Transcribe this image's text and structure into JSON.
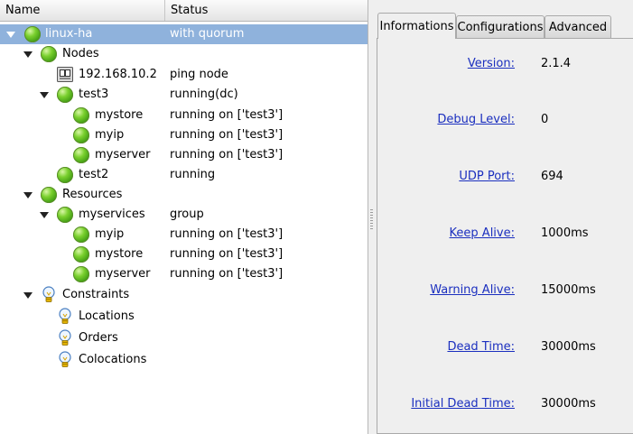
{
  "tree": {
    "columns": {
      "name": "Name",
      "status": "Status"
    },
    "rows": [
      {
        "label": "linux-ha",
        "status": "with quorum"
      },
      {
        "label": "Nodes",
        "status": ""
      },
      {
        "label": "192.168.10.2",
        "status": "ping node"
      },
      {
        "label": "test3",
        "status": "running(dc)"
      },
      {
        "label": "mystore",
        "status": "running on ['test3']"
      },
      {
        "label": "myip",
        "status": "running on ['test3']"
      },
      {
        "label": "myserver",
        "status": "running on ['test3']"
      },
      {
        "label": "test2",
        "status": "running"
      },
      {
        "label": "Resources",
        "status": ""
      },
      {
        "label": "myservices",
        "status": "group"
      },
      {
        "label": "myip",
        "status": "running on ['test3']"
      },
      {
        "label": "mystore",
        "status": "running on ['test3']"
      },
      {
        "label": "myserver",
        "status": "running on ['test3']"
      },
      {
        "label": "Constraints",
        "status": ""
      },
      {
        "label": "Locations",
        "status": ""
      },
      {
        "label": "Orders",
        "status": ""
      },
      {
        "label": "Colocations",
        "status": ""
      }
    ]
  },
  "tabs": [
    {
      "label": "Informations"
    },
    {
      "label": "Configurations"
    },
    {
      "label": "Advanced"
    }
  ],
  "info": [
    {
      "key": "Version:",
      "value": "2.1.4"
    },
    {
      "key": "Debug Level:",
      "value": "0"
    },
    {
      "key": "UDP Port:",
      "value": "694"
    },
    {
      "key": "Keep Alive:",
      "value": "1000ms"
    },
    {
      "key": "Warning Alive:",
      "value": "15000ms"
    },
    {
      "key": "Dead Time:",
      "value": "30000ms"
    },
    {
      "key": "Initial Dead Time:",
      "value": "30000ms"
    }
  ],
  "colors": {
    "selection": "#8fb2dc",
    "link": "#1b2fbf",
    "status_ok": "#5fbf1f"
  }
}
